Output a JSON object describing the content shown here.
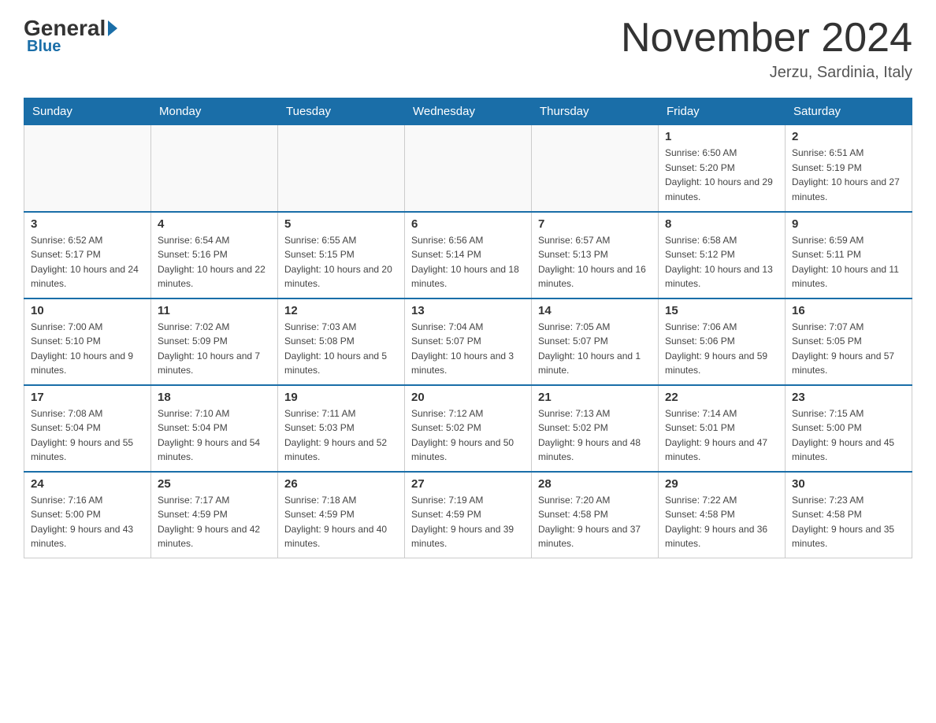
{
  "logo": {
    "general": "General",
    "blue": "Blue",
    "tagline": "Blue"
  },
  "header": {
    "title": "November 2024",
    "location": "Jerzu, Sardinia, Italy"
  },
  "weekdays": [
    "Sunday",
    "Monday",
    "Tuesday",
    "Wednesday",
    "Thursday",
    "Friday",
    "Saturday"
  ],
  "weeks": [
    [
      {
        "day": "",
        "info": ""
      },
      {
        "day": "",
        "info": ""
      },
      {
        "day": "",
        "info": ""
      },
      {
        "day": "",
        "info": ""
      },
      {
        "day": "",
        "info": ""
      },
      {
        "day": "1",
        "info": "Sunrise: 6:50 AM\nSunset: 5:20 PM\nDaylight: 10 hours and 29 minutes."
      },
      {
        "day": "2",
        "info": "Sunrise: 6:51 AM\nSunset: 5:19 PM\nDaylight: 10 hours and 27 minutes."
      }
    ],
    [
      {
        "day": "3",
        "info": "Sunrise: 6:52 AM\nSunset: 5:17 PM\nDaylight: 10 hours and 24 minutes."
      },
      {
        "day": "4",
        "info": "Sunrise: 6:54 AM\nSunset: 5:16 PM\nDaylight: 10 hours and 22 minutes."
      },
      {
        "day": "5",
        "info": "Sunrise: 6:55 AM\nSunset: 5:15 PM\nDaylight: 10 hours and 20 minutes."
      },
      {
        "day": "6",
        "info": "Sunrise: 6:56 AM\nSunset: 5:14 PM\nDaylight: 10 hours and 18 minutes."
      },
      {
        "day": "7",
        "info": "Sunrise: 6:57 AM\nSunset: 5:13 PM\nDaylight: 10 hours and 16 minutes."
      },
      {
        "day": "8",
        "info": "Sunrise: 6:58 AM\nSunset: 5:12 PM\nDaylight: 10 hours and 13 minutes."
      },
      {
        "day": "9",
        "info": "Sunrise: 6:59 AM\nSunset: 5:11 PM\nDaylight: 10 hours and 11 minutes."
      }
    ],
    [
      {
        "day": "10",
        "info": "Sunrise: 7:00 AM\nSunset: 5:10 PM\nDaylight: 10 hours and 9 minutes."
      },
      {
        "day": "11",
        "info": "Sunrise: 7:02 AM\nSunset: 5:09 PM\nDaylight: 10 hours and 7 minutes."
      },
      {
        "day": "12",
        "info": "Sunrise: 7:03 AM\nSunset: 5:08 PM\nDaylight: 10 hours and 5 minutes."
      },
      {
        "day": "13",
        "info": "Sunrise: 7:04 AM\nSunset: 5:07 PM\nDaylight: 10 hours and 3 minutes."
      },
      {
        "day": "14",
        "info": "Sunrise: 7:05 AM\nSunset: 5:07 PM\nDaylight: 10 hours and 1 minute."
      },
      {
        "day": "15",
        "info": "Sunrise: 7:06 AM\nSunset: 5:06 PM\nDaylight: 9 hours and 59 minutes."
      },
      {
        "day": "16",
        "info": "Sunrise: 7:07 AM\nSunset: 5:05 PM\nDaylight: 9 hours and 57 minutes."
      }
    ],
    [
      {
        "day": "17",
        "info": "Sunrise: 7:08 AM\nSunset: 5:04 PM\nDaylight: 9 hours and 55 minutes."
      },
      {
        "day": "18",
        "info": "Sunrise: 7:10 AM\nSunset: 5:04 PM\nDaylight: 9 hours and 54 minutes."
      },
      {
        "day": "19",
        "info": "Sunrise: 7:11 AM\nSunset: 5:03 PM\nDaylight: 9 hours and 52 minutes."
      },
      {
        "day": "20",
        "info": "Sunrise: 7:12 AM\nSunset: 5:02 PM\nDaylight: 9 hours and 50 minutes."
      },
      {
        "day": "21",
        "info": "Sunrise: 7:13 AM\nSunset: 5:02 PM\nDaylight: 9 hours and 48 minutes."
      },
      {
        "day": "22",
        "info": "Sunrise: 7:14 AM\nSunset: 5:01 PM\nDaylight: 9 hours and 47 minutes."
      },
      {
        "day": "23",
        "info": "Sunrise: 7:15 AM\nSunset: 5:00 PM\nDaylight: 9 hours and 45 minutes."
      }
    ],
    [
      {
        "day": "24",
        "info": "Sunrise: 7:16 AM\nSunset: 5:00 PM\nDaylight: 9 hours and 43 minutes."
      },
      {
        "day": "25",
        "info": "Sunrise: 7:17 AM\nSunset: 4:59 PM\nDaylight: 9 hours and 42 minutes."
      },
      {
        "day": "26",
        "info": "Sunrise: 7:18 AM\nSunset: 4:59 PM\nDaylight: 9 hours and 40 minutes."
      },
      {
        "day": "27",
        "info": "Sunrise: 7:19 AM\nSunset: 4:59 PM\nDaylight: 9 hours and 39 minutes."
      },
      {
        "day": "28",
        "info": "Sunrise: 7:20 AM\nSunset: 4:58 PM\nDaylight: 9 hours and 37 minutes."
      },
      {
        "day": "29",
        "info": "Sunrise: 7:22 AM\nSunset: 4:58 PM\nDaylight: 9 hours and 36 minutes."
      },
      {
        "day": "30",
        "info": "Sunrise: 7:23 AM\nSunset: 4:58 PM\nDaylight: 9 hours and 35 minutes."
      }
    ]
  ]
}
